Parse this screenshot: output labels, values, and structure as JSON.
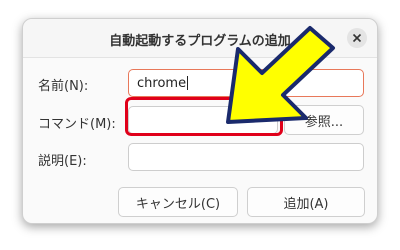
{
  "dialog": {
    "title": "自動起動するプログラムの追加",
    "fields": {
      "name_label": "名前(N):",
      "name_value": "chrome",
      "command_label": "コマンド(M):",
      "command_value": "",
      "description_label": "説明(E):",
      "description_value": ""
    },
    "browse_label": "参照...",
    "cancel_label": "キャンセル(C)",
    "add_label": "追加(A)"
  },
  "icons": {
    "close": "close-icon",
    "annotation_arrow": "arrow-icon"
  },
  "colors": {
    "highlight_border": "#e0001a",
    "arrow_fill": "#ffff00",
    "arrow_outline": "#1a2a6c",
    "focus_border": "#e8785a"
  }
}
